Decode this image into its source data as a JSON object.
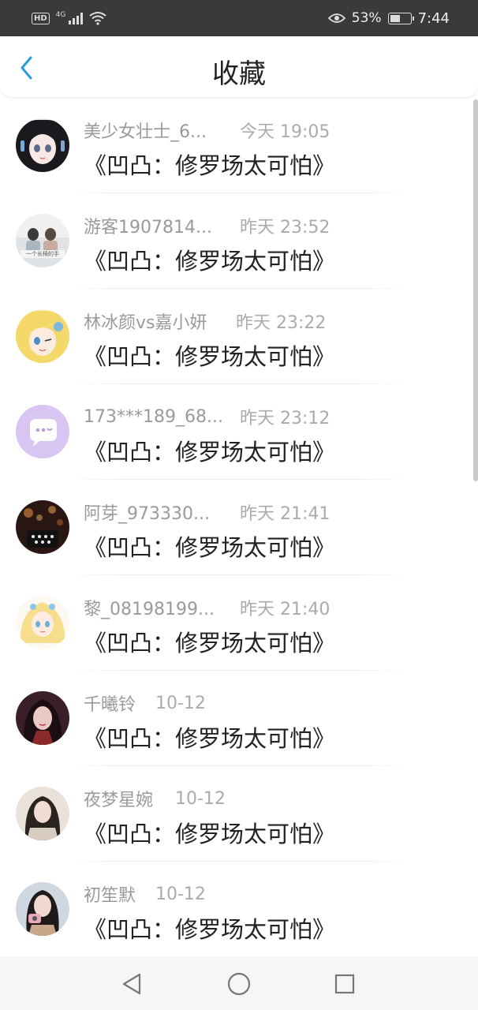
{
  "status_bar": {
    "hd": "HD",
    "network": "4G",
    "battery_pct": "53%",
    "battery_level": 0.53,
    "time": "7:44"
  },
  "header": {
    "title": "收藏",
    "back_icon": "chevron-left-icon",
    "accent_color": "#2a9be0"
  },
  "favorites": [
    {
      "user": "美少女壮士_6...",
      "time": "今天 19:05",
      "title": "《凹凸：修罗场太可怕》"
    },
    {
      "user": "游客1907814...",
      "time": "昨天 23:52",
      "title": "《凹凸：修罗场太可怕》",
      "avatar_text": "一个长椅的手"
    },
    {
      "user": "林冰颜vs嘉小妍",
      "time": "昨天 23:22",
      "title": "《凹凸：修罗场太可怕》"
    },
    {
      "user": "173***189_68...",
      "time": "昨天 23:12",
      "title": "《凹凸：修罗场太可怕》"
    },
    {
      "user": "阿芽_973330...",
      "time": "昨天 21:41",
      "title": "《凹凸：修罗场太可怕》"
    },
    {
      "user": "黎_08198199...",
      "time": "昨天 21:40",
      "title": "《凹凸：修罗场太可怕》"
    },
    {
      "user": "千曦铃",
      "time": "10-12",
      "title": "《凹凸：修罗场太可怕》"
    },
    {
      "user": "夜梦星婉",
      "time": "10-12",
      "title": "《凹凸：修罗场太可怕》"
    },
    {
      "user": "初笙默",
      "time": "10-12",
      "title": "《凹凸：修罗场太可怕》"
    }
  ],
  "nav_bar": {
    "back": "triangle-back-icon",
    "home": "circle-home-icon",
    "recents": "square-recents-icon"
  }
}
